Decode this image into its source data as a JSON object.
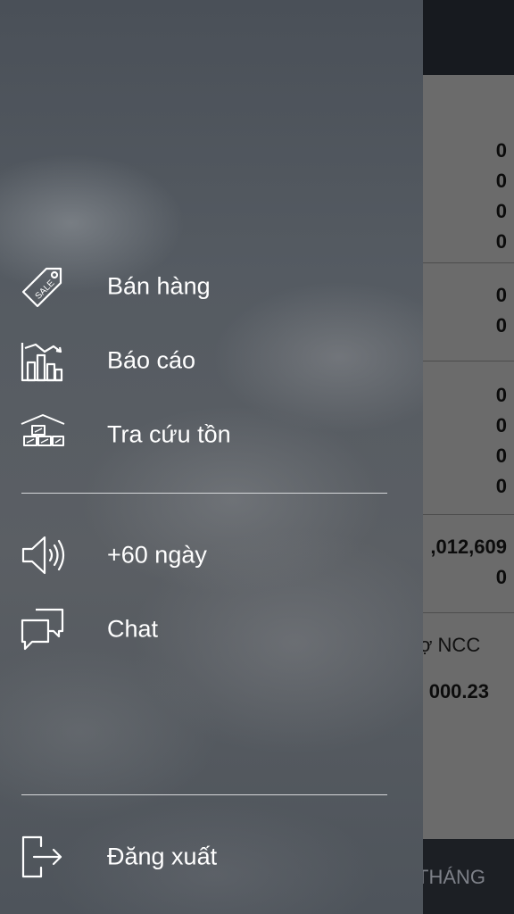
{
  "background": {
    "bottom_tab_label": "THÁNG",
    "values": [
      "0",
      "0",
      "0",
      "0",
      "0",
      "0",
      "0",
      "0",
      "0",
      "0",
      ",012,609",
      "0"
    ],
    "supplier_debt_label": "ợ NCC",
    "supplier_debt_value": "000.23"
  },
  "drawer": {
    "primary_items": [
      {
        "label": "Bán hàng",
        "icon": "sale-tag-icon"
      },
      {
        "label": "Báo cáo",
        "icon": "report-chart-icon"
      },
      {
        "label": "Tra cứu tồn",
        "icon": "inventory-icon"
      }
    ],
    "secondary_items": [
      {
        "label": "+60 ngày",
        "icon": "speaker-icon"
      },
      {
        "label": "Chat",
        "icon": "chat-icon"
      }
    ],
    "logout": {
      "label": "Đăng xuất",
      "icon": "logout-icon"
    }
  },
  "colors": {
    "drawer_text": "#ffffff",
    "divider": "#d6d8da",
    "topbar": "#171a1f"
  }
}
